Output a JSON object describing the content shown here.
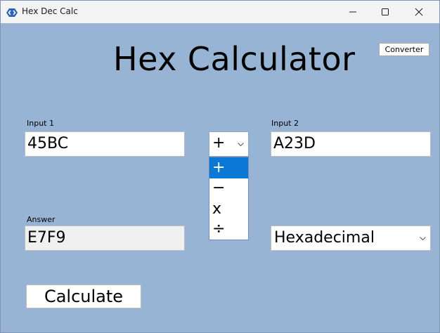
{
  "window": {
    "title": "Hex Dec Calc",
    "icon": "hex-calc-app-icon",
    "controls": {
      "minimize_icon": "minimize-icon",
      "maximize_icon": "maximize-icon",
      "close_icon": "close-icon"
    }
  },
  "header": {
    "title": "Hex Calculator",
    "converter_label": "Converter"
  },
  "inputs": {
    "input1_label": "Input 1",
    "input1_value": "45BC",
    "input2_label": "Input 2",
    "input2_value": "A23D",
    "answer_label": "Answer",
    "answer_value": "E7F9"
  },
  "operator": {
    "selected": "+",
    "options": [
      "+",
      "−",
      "x",
      "÷"
    ],
    "highlighted_index": 0
  },
  "base": {
    "selected": "Hexadecimal"
  },
  "actions": {
    "calculate_label": "Calculate"
  },
  "colors": {
    "background": "#98b4d4",
    "titlebar": "#f3f3f3",
    "selection": "#0a78d4"
  }
}
